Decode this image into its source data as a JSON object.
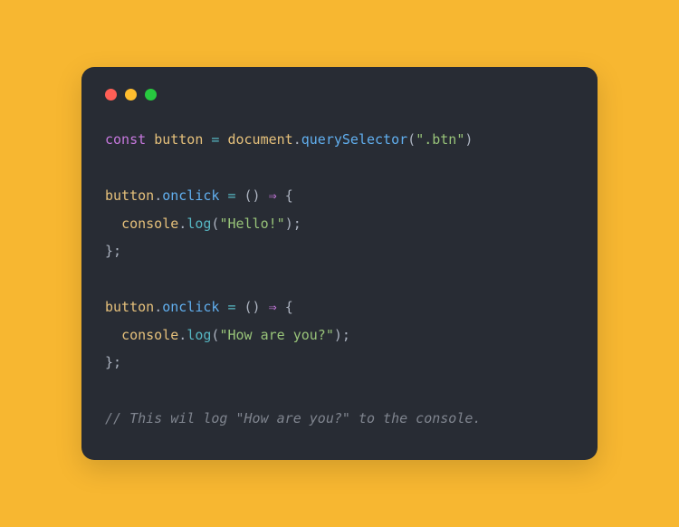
{
  "code": {
    "line1": {
      "const": "const",
      "button": "button",
      "eq": " = ",
      "document": "document",
      "dot": ".",
      "querySelector": "querySelector",
      "openParen": "(",
      "btnStr": "\".btn\"",
      "closeParen": ")"
    },
    "line3": {
      "button": "button",
      "dot": ".",
      "onclick": "onclick",
      "eq": " = ",
      "parens": "()",
      "arrow": " ⇒ ",
      "openBrace": "{"
    },
    "line4": {
      "indent": "  ",
      "console": "console",
      "dot": ".",
      "log": "log",
      "openParen": "(",
      "str": "\"Hello!\"",
      "closeParen": ")",
      "semi": ";"
    },
    "line5": {
      "closeBrace": "};"
    },
    "line7": {
      "button": "button",
      "dot": ".",
      "onclick": "onclick",
      "eq": " = ",
      "parens": "()",
      "arrow": " ⇒ ",
      "openBrace": "{"
    },
    "line8": {
      "indent": "  ",
      "console": "console",
      "dot": ".",
      "log": "log",
      "openParen": "(",
      "str": "\"How are you?\"",
      "closeParen": ")",
      "semi": ";"
    },
    "line9": {
      "closeBrace": "};"
    },
    "line11": {
      "comment": "// This wil log \"How are you?\" to the console."
    }
  }
}
